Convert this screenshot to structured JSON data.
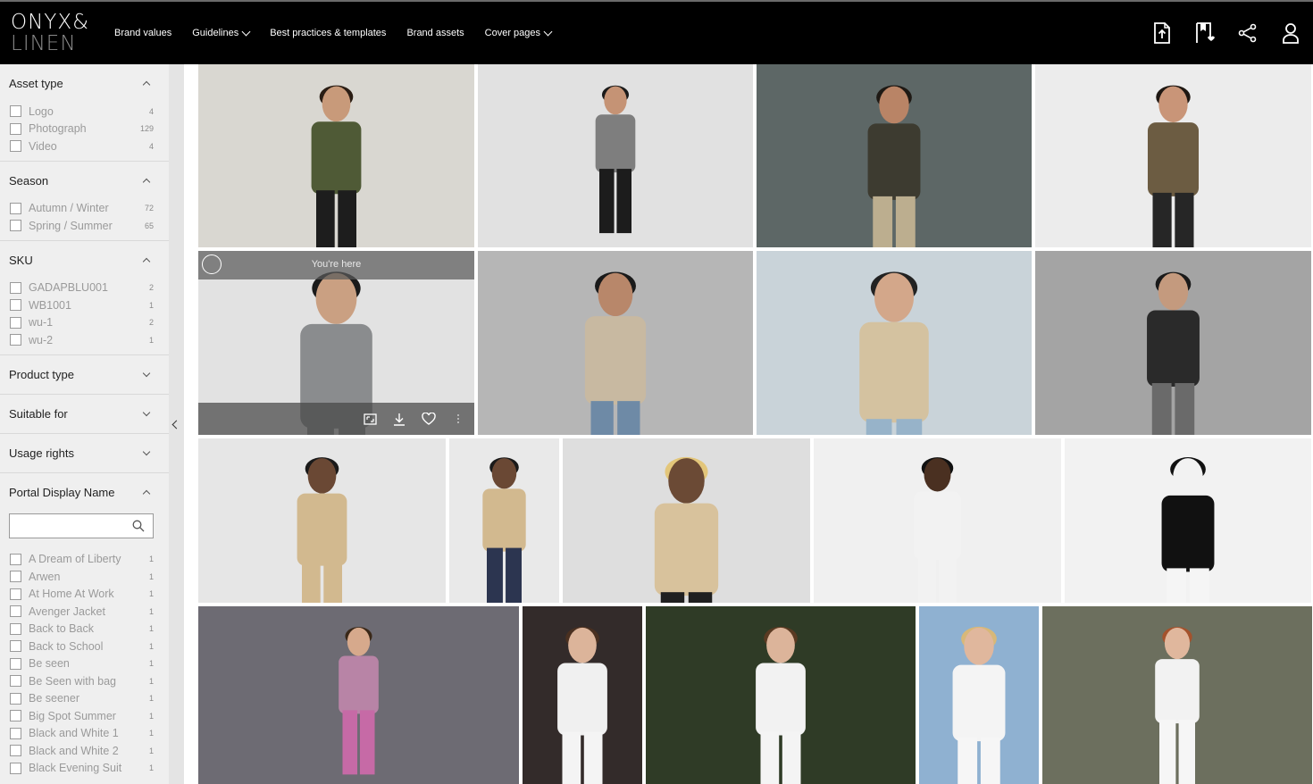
{
  "brand": {
    "line1": "ONYX&",
    "line2": "LINEN"
  },
  "nav": [
    {
      "label": "Brand values"
    },
    {
      "label": "Guidelines"
    },
    {
      "label": "Best practices & templates"
    },
    {
      "label": "Brand assets"
    },
    {
      "label": "Cover pages"
    }
  ],
  "header_icons": [
    "download-file-icon",
    "bookmark-icon",
    "share-icon",
    "user-icon"
  ],
  "filters": {
    "asset_type": {
      "title": "Asset type",
      "options": [
        {
          "label": "Logo",
          "count": "4"
        },
        {
          "label": "Photograph",
          "count": "129"
        },
        {
          "label": "Video",
          "count": "4"
        }
      ]
    },
    "season": {
      "title": "Season",
      "options": [
        {
          "label": "Autumn / Winter",
          "count": "72"
        },
        {
          "label": "Spring / Summer",
          "count": "65"
        }
      ]
    },
    "sku": {
      "title": "SKU",
      "options": [
        {
          "label": "GADAPBLU001",
          "count": "2"
        },
        {
          "label": "WB1001",
          "count": "1"
        },
        {
          "label": "wu-1",
          "count": "2"
        },
        {
          "label": "wu-2",
          "count": "1"
        }
      ]
    },
    "product_type": {
      "title": "Product type"
    },
    "suitable_for": {
      "title": "Suitable for"
    },
    "usage_rights": {
      "title": "Usage rights"
    },
    "portal_display_name": {
      "title": "Portal Display Name",
      "search_placeholder": "",
      "options": [
        {
          "label": "A Dream of Liberty",
          "count": "1"
        },
        {
          "label": "Arwen",
          "count": "1"
        },
        {
          "label": "At Home At Work",
          "count": "1"
        },
        {
          "label": "Avenger Jacket",
          "count": "1"
        },
        {
          "label": "Back to Back",
          "count": "1"
        },
        {
          "label": "Back to School",
          "count": "1"
        },
        {
          "label": "Be seen",
          "count": "1"
        },
        {
          "label": "Be Seen with bag",
          "count": "1"
        },
        {
          "label": "Be seener",
          "count": "1"
        },
        {
          "label": "Big Spot Summer",
          "count": "1"
        },
        {
          "label": "Black and White 1",
          "count": "1"
        },
        {
          "label": "Black and White 2",
          "count": "1"
        },
        {
          "label": "Black Evening Suit",
          "count": "1"
        }
      ]
    }
  },
  "gallery": {
    "hover_label": "You're here",
    "tiles": [
      {
        "bg": "#d9d7d1",
        "skin": "#c89a7a",
        "top": "#4f5a36",
        "bottom": "#1d1d1d",
        "hair": "#2a1d14",
        "scale": 0.9
      },
      {
        "bg": "#e1e1e1",
        "skin": "#c59375",
        "top": "#7e7e7e",
        "bottom": "#1c1c1c",
        "hair": "#1a1a1a",
        "scale": 0.72
      },
      {
        "bg": "#5d6766",
        "skin": "#b98466",
        "top": "#3d3b30",
        "bottom": "#bcae8f",
        "hair": "#1e1914",
        "scale": 0.95
      },
      {
        "bg": "#ececec",
        "skin": "#c99578",
        "top": "#6c5c42",
        "bottom": "#262626",
        "hair": "#1e1712",
        "scale": 0.92
      },
      {
        "bg": "#e2e2e2",
        "skin": "#caa082",
        "top": "#8a8c8e",
        "bottom": "#8a8c8e",
        "hair": "#1a1a1a",
        "scale": 1.3
      },
      {
        "bg": "#b6b6b6",
        "skin": "#b8876a",
        "top": "#c8b9a1",
        "bottom": "#6e8aa6",
        "hair": "#1a1a1a",
        "scale": 1.1
      },
      {
        "bg": "#c9d3d9",
        "skin": "#d3a78a",
        "top": "#d4c2a0",
        "bottom": "#97b3c9",
        "hair": "#222",
        "scale": 1.25
      },
      {
        "bg": "#a4a4a4",
        "skin": "#c49a7e",
        "top": "#2a2a2a",
        "bottom": "#6a6a6a",
        "hair": "#1a1a1a",
        "scale": 0.95
      },
      {
        "bg": "#e6e6e6",
        "skin": "#6a4834",
        "top": "#d2b98f",
        "bottom": "#d2b98f",
        "hair": "#1a1a1a",
        "scale": 0.9
      },
      {
        "bg": "#e9e9e9",
        "skin": "#6a4834",
        "top": "#d2b98f",
        "bottom": "#2c3550",
        "hair": "#1a1a1a",
        "scale": 0.78
      },
      {
        "bg": "#dedede",
        "skin": "#6b4a35",
        "top": "#d8c29c",
        "bottom": "#202020",
        "hair": "#e3c67a",
        "scale": 1.15
      },
      {
        "bg": "#f0f0f0",
        "skin": "#4a3021",
        "top": "#f2f2f2",
        "bottom": "#f2f2f2",
        "hair": "#111",
        "scale": 0.85
      },
      {
        "bg": "#f2f2f2",
        "skin": "#f2f2f2",
        "top": "#111111",
        "bottom": "#f5f5f5",
        "hair": "#111",
        "scale": 0.95
      },
      {
        "bg": "#6d6b73",
        "skin": "#d6a98c",
        "top": "#b884a6",
        "bottom": "#c66aa6",
        "hair": "#3a2818",
        "scale": 0.72
      },
      {
        "bg": "#332b2a",
        "skin": "#dcb49a",
        "top": "#f0f0f0",
        "bottom": "#f4f4f4",
        "hair": "#4a3020",
        "scale": 0.9
      },
      {
        "bg": "#2f3b26",
        "skin": "#dcb49a",
        "top": "#f2f2f2",
        "bottom": "#f4f4f4",
        "hair": "#5a3a22",
        "scale": 0.9
      },
      {
        "bg": "#8fb1d1",
        "skin": "#e0b79d",
        "top": "#f4f4f4",
        "bottom": "#f6f6f6",
        "hair": "#d8b878",
        "scale": 0.95
      },
      {
        "bg": "#6c6f5e",
        "skin": "#e0b79d",
        "top": "#f2f2f2",
        "bottom": "#f6f6f6",
        "hair": "#a4522c",
        "scale": 0.8
      }
    ]
  }
}
